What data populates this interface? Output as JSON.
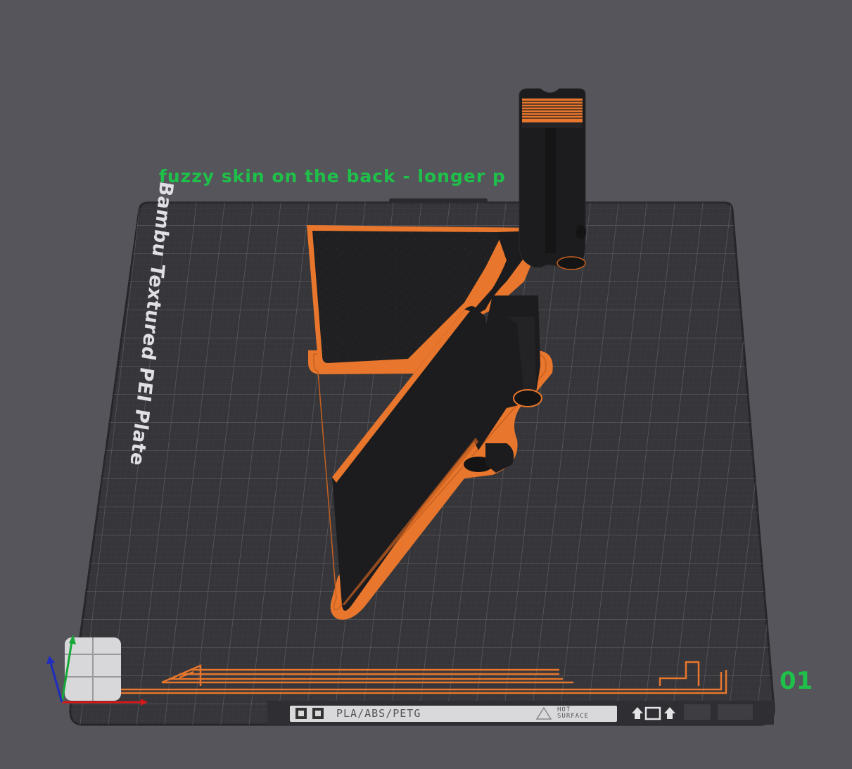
{
  "viewport": {
    "plate_name": "fuzzy skin on the back - longer p",
    "plate_number": "01",
    "plate_brand": "Bambu Textured PEI Plate",
    "plate_label": "PLA/ABS/PETG",
    "hot_surface_line1": "HOT",
    "hot_surface_line2": "SURFACE"
  },
  "colors": {
    "background": "#55555b",
    "plate": "#36363a",
    "filament": "#e8762c",
    "model": "#1c1c1e",
    "label_text": "#1fc04a"
  },
  "icons": {
    "axis": "axis-gizmo-icon",
    "view_cube": "view-cube-icon",
    "warning": "warning-triangle-icon",
    "qr": "qr-code-icon"
  }
}
